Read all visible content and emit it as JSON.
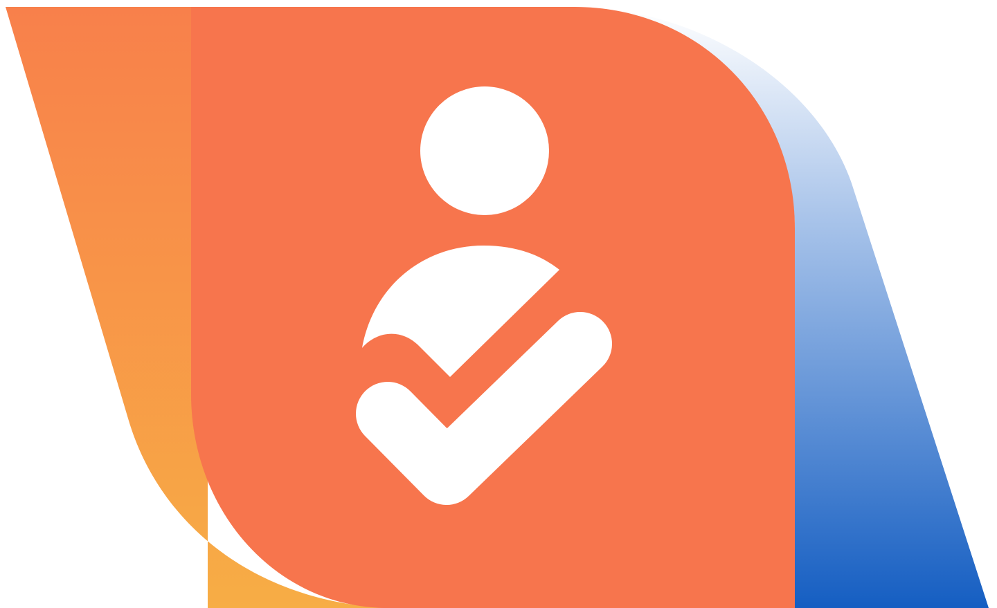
{
  "logo": {
    "icon": "person-check-icon",
    "colors": {
      "background": "#ffffff",
      "panel_main": "#f7754d",
      "panel_left_top": "#f8804b",
      "panel_left_bottom": "#f7ad45",
      "panel_right_top": "#ffffff",
      "panel_right_mid": "#a9c4ea",
      "panel_right_bottom": "#155ec2",
      "glyph": "#ffffff"
    }
  }
}
